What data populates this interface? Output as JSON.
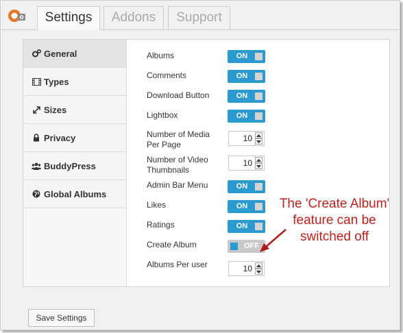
{
  "colors": {
    "accent": "#2a9ad0",
    "annotation": "#c0201a",
    "toggle_off": "#c9c9c9"
  },
  "logo": {
    "icon": "camera-logo-icon"
  },
  "tabs": [
    {
      "label": "Settings",
      "active": true
    },
    {
      "label": "Addons",
      "active": false
    },
    {
      "label": "Support",
      "active": false
    }
  ],
  "sidebar": {
    "items": [
      {
        "label": "General",
        "icon": "gears-icon",
        "active": true
      },
      {
        "label": "Types",
        "icon": "film-icon",
        "active": false
      },
      {
        "label": "Sizes",
        "icon": "resize-icon",
        "active": false
      },
      {
        "label": "Privacy",
        "icon": "lock-icon",
        "active": false
      },
      {
        "label": "BuddyPress",
        "icon": "users-icon",
        "active": false
      },
      {
        "label": "Global Albums",
        "icon": "globe-icon",
        "active": false
      }
    ]
  },
  "settings": [
    {
      "label": "Albums",
      "type": "toggle",
      "state": "ON"
    },
    {
      "label": "Comments",
      "type": "toggle",
      "state": "ON"
    },
    {
      "label": "Download Button",
      "type": "toggle",
      "state": "ON"
    },
    {
      "label": "Lightbox",
      "type": "toggle",
      "state": "ON"
    },
    {
      "label": "Number of Media Per Page",
      "type": "number",
      "value": "10"
    },
    {
      "label": "Number of Video Thumbnails",
      "type": "number",
      "value": "10"
    },
    {
      "label": "Admin Bar Menu",
      "type": "toggle",
      "state": "ON"
    },
    {
      "label": "Likes",
      "type": "toggle",
      "state": "ON"
    },
    {
      "label": "Ratings",
      "type": "toggle",
      "state": "ON"
    },
    {
      "label": "Create Album",
      "type": "toggle",
      "state": "OFF"
    },
    {
      "label": "Albums Per user",
      "type": "number",
      "value": "10"
    }
  ],
  "annotation": {
    "line1": "The 'Create Album'",
    "line2": "feature can be",
    "line3": "switched off"
  },
  "footer": {
    "save_label": "Save Settings"
  }
}
